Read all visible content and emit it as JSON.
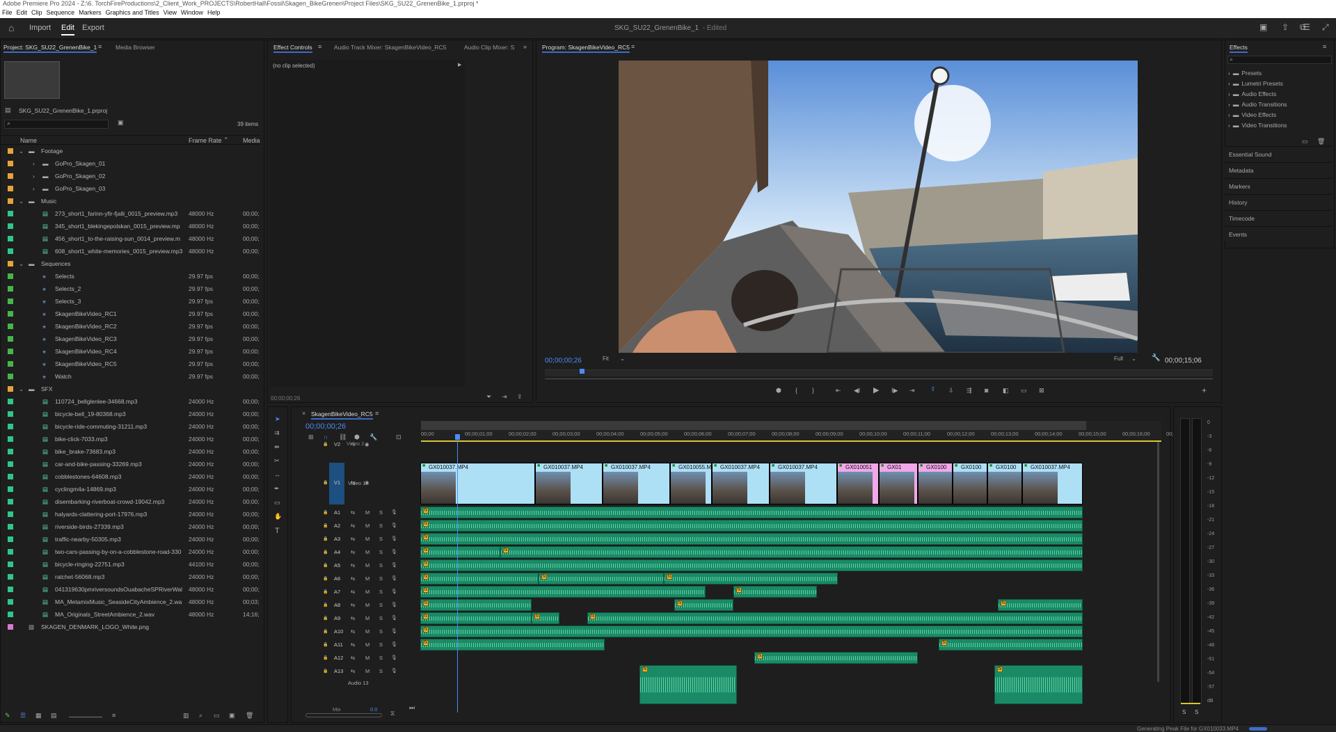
{
  "app": {
    "title": "Adobe Premiere Pro 2024 - Z:\\6. TorchFireProductions\\2_Client_Work_PROJECTS\\RobertHall\\Fossil\\Skagen_BikeGrenen\\Project Files\\SKG_SU22_GrenenBike_1.prproj *"
  },
  "menu": [
    "File",
    "Edit",
    "Clip",
    "Sequence",
    "Markers",
    "Graphics and Titles",
    "View",
    "Window",
    "Help"
  ],
  "header": {
    "tabs": [
      "Import",
      "Edit",
      "Export"
    ],
    "active": "Edit",
    "project_title": "SKG_SU22_GrenenBike_1",
    "edited": "- Edited"
  },
  "project": {
    "tabs": [
      "Project: SKG_SU22_GrenenBike_1",
      "Media Browser"
    ],
    "file": "SKG_SU22_GrenenBike_1.prproj",
    "count": "39 items",
    "col_name": "Name",
    "col_frame": "Frame Rate",
    "col_media": "Media",
    "rows": [
      {
        "name": "Footage",
        "lvl": 1,
        "type": "bin",
        "color": "#e8a23a",
        "fr": "",
        "md": ""
      },
      {
        "name": "GoPro_Skagen_01",
        "lvl": 2,
        "type": "bin",
        "color": "#e8a23a",
        "fr": "",
        "md": ""
      },
      {
        "name": "GoPro_Skagen_02",
        "lvl": 2,
        "type": "bin",
        "color": "#e8a23a",
        "fr": "",
        "md": ""
      },
      {
        "name": "GoPro_Skagen_03",
        "lvl": 2,
        "type": "bin",
        "color": "#e8a23a",
        "fr": "",
        "md": ""
      },
      {
        "name": "Music",
        "lvl": 1,
        "type": "bin",
        "color": "#e8a23a",
        "fr": "",
        "md": ""
      },
      {
        "name": "273_short1_farinn-yfir-fjalli_0015_preview.mp3",
        "lvl": 2,
        "type": "audio",
        "color": "#2fc68a",
        "fr": "48000 Hz",
        "md": "00;00;"
      },
      {
        "name": "345_short1_blekingepolskan_0015_preview.mp",
        "lvl": 2,
        "type": "audio",
        "color": "#2fc68a",
        "fr": "48000 Hz",
        "md": "00;00;"
      },
      {
        "name": "456_short1_to-the-raising-sun_0014_preview.m",
        "lvl": 2,
        "type": "audio",
        "color": "#2fc68a",
        "fr": "48000 Hz",
        "md": "00;00;"
      },
      {
        "name": "608_short1_white-memories_0015_preview.mp3",
        "lvl": 2,
        "type": "audio",
        "color": "#2fc68a",
        "fr": "48000 Hz",
        "md": "00;00;"
      },
      {
        "name": "Sequences",
        "lvl": 1,
        "type": "bin",
        "color": "#e8a23a",
        "fr": "",
        "md": ""
      },
      {
        "name": "Selects",
        "lvl": 2,
        "type": "seq",
        "color": "#47b54a",
        "fr": "29.97 fps",
        "md": "00;00;"
      },
      {
        "name": "Selects_2",
        "lvl": 2,
        "type": "seq",
        "color": "#47b54a",
        "fr": "29.97 fps",
        "md": "00;00;"
      },
      {
        "name": "Selects_3",
        "lvl": 2,
        "type": "seq",
        "color": "#47b54a",
        "fr": "29.97 fps",
        "md": "00;00;"
      },
      {
        "name": "SkagenBikeVideo_RC1",
        "lvl": 2,
        "type": "seq",
        "color": "#47b54a",
        "fr": "29.97 fps",
        "md": "00;00;"
      },
      {
        "name": "SkagenBikeVideo_RC2",
        "lvl": 2,
        "type": "seq",
        "color": "#47b54a",
        "fr": "29.97 fps",
        "md": "00;00;"
      },
      {
        "name": "SkagenBikeVideo_RC3",
        "lvl": 2,
        "type": "seq",
        "color": "#47b54a",
        "fr": "29.97 fps",
        "md": "00;00;"
      },
      {
        "name": "SkagenBikeVideo_RC4",
        "lvl": 2,
        "type": "seq",
        "color": "#47b54a",
        "fr": "29.97 fps",
        "md": "00;00;"
      },
      {
        "name": "SkagenBikeVideo_RC5",
        "lvl": 2,
        "type": "seq",
        "color": "#47b54a",
        "fr": "29.97 fps",
        "md": "00;00;"
      },
      {
        "name": "Watch",
        "lvl": 2,
        "type": "seq",
        "color": "#47b54a",
        "fr": "29.97 fps",
        "md": "00;00;"
      },
      {
        "name": "SFX",
        "lvl": 1,
        "type": "bin",
        "color": "#e8a23a",
        "fr": "",
        "md": ""
      },
      {
        "name": "110724_bellglenlee-34668.mp3",
        "lvl": 2,
        "type": "audio",
        "color": "#2fc68a",
        "fr": "24000 Hz",
        "md": "00;00;"
      },
      {
        "name": "bicycle-bell_19-80368.mp3",
        "lvl": 2,
        "type": "audio",
        "color": "#2fc68a",
        "fr": "24000 Hz",
        "md": "00;00;"
      },
      {
        "name": "bicycle-ride-commuting-31211.mp3",
        "lvl": 2,
        "type": "audio",
        "color": "#2fc68a",
        "fr": "24000 Hz",
        "md": "00;00;"
      },
      {
        "name": "bike-click-7033.mp3",
        "lvl": 2,
        "type": "audio",
        "color": "#2fc68a",
        "fr": "24000 Hz",
        "md": "00;00;"
      },
      {
        "name": "bike_brake-73683.mp3",
        "lvl": 2,
        "type": "audio",
        "color": "#2fc68a",
        "fr": "24000 Hz",
        "md": "00;00;"
      },
      {
        "name": "car-and-bike-passing-33269.mp3",
        "lvl": 2,
        "type": "audio",
        "color": "#2fc68a",
        "fr": "24000 Hz",
        "md": "00;00;"
      },
      {
        "name": "cobblestones-64608.mp3",
        "lvl": 2,
        "type": "audio",
        "color": "#2fc68a",
        "fr": "24000 Hz",
        "md": "00;00;"
      },
      {
        "name": "cyclingm4a-14869.mp3",
        "lvl": 2,
        "type": "audio",
        "color": "#2fc68a",
        "fr": "24000 Hz",
        "md": "00;00;"
      },
      {
        "name": "disembarking-riverboat-crowd-19042.mp3",
        "lvl": 2,
        "type": "audio",
        "color": "#2fc68a",
        "fr": "24000 Hz",
        "md": "00;00;"
      },
      {
        "name": "halyards-clattering-port-17976.mp3",
        "lvl": 2,
        "type": "audio",
        "color": "#2fc68a",
        "fr": "24000 Hz",
        "md": "00;00;"
      },
      {
        "name": "riverside-birds-27339.mp3",
        "lvl": 2,
        "type": "audio",
        "color": "#2fc68a",
        "fr": "24000 Hz",
        "md": "00;00;"
      },
      {
        "name": "traffic-nearby-50305.mp3",
        "lvl": 2,
        "type": "audio",
        "color": "#2fc68a",
        "fr": "24000 Hz",
        "md": "00;00;"
      },
      {
        "name": "two-cars-passing-by-on-a-cobblestone-road-330",
        "lvl": 2,
        "type": "audio",
        "color": "#2fc68a",
        "fr": "24000 Hz",
        "md": "00;00;"
      },
      {
        "name": "bicycle-ringing-22751.mp3",
        "lvl": 2,
        "type": "audio",
        "color": "#2fc68a",
        "fr": "44100 Hz",
        "md": "00;00;"
      },
      {
        "name": "ratchet-56068.mp3",
        "lvl": 2,
        "type": "audio",
        "color": "#2fc68a",
        "fr": "24000 Hz",
        "md": "00;00;"
      },
      {
        "name": "041319630pmriversoundsOuabacheSPRiverWal",
        "lvl": 2,
        "type": "audio",
        "color": "#2fc68a",
        "fr": "48000 Hz",
        "md": "00;00;"
      },
      {
        "name": "MA_MetamixMusic_SeasideCityAmbience_2.wa",
        "lvl": 2,
        "type": "audio",
        "color": "#2fc68a",
        "fr": "48000 Hz",
        "md": "00;03;"
      },
      {
        "name": "MA_Originals_StreetAmbience_2.wav",
        "lvl": 2,
        "type": "audio",
        "color": "#2fc68a",
        "fr": "48000 Hz",
        "md": "14;16;"
      },
      {
        "name": "SKAGEN_DENMARK_LOGO_White.png",
        "lvl": 1,
        "type": "image",
        "color": "#d97ad0",
        "fr": "",
        "md": ""
      }
    ]
  },
  "effect_controls": {
    "tabs": [
      "Effect Controls",
      "Audio Track Mixer: SkagenBikeVideo_RC5",
      "Audio Clip Mixer: S"
    ],
    "no_clip": "(no clip selected)",
    "time": "00;00;00;26"
  },
  "program": {
    "tab": "Program: SkagenBikeVideo_RC5",
    "timecode": "00;00;00;26",
    "fit": "Fit",
    "full": "Full",
    "duration": "00;00;15;06"
  },
  "effects": {
    "tab": "Effects",
    "items": [
      "Presets",
      "Lumetri Presets",
      "Audio Effects",
      "Audio Transitions",
      "Video Effects",
      "Video Transitions"
    ],
    "sections": [
      "Essential Sound",
      "Metadata",
      "Markers",
      "History",
      "Timecode",
      "Events"
    ]
  },
  "timeline": {
    "tab": "SkagenBikeVideo_RC5",
    "timecode": "00;00;00;26",
    "ruler": [
      "00;00",
      "00;00;01;00",
      "00;00;02;00",
      "00;00;03;00",
      "00;00;04;00",
      "00;00;05;00",
      "00;00;06;00",
      "00;00;07;00",
      "00;00;08;00",
      "00;00;09;00",
      "00;00;10;00",
      "00;00;11;00",
      "00;00;12;00",
      "00;00;13;00",
      "00;00;14;00",
      "00;00;15;00",
      "00;00;16;00",
      "00;"
    ],
    "v2": "V2",
    "video2": "Video 2",
    "v1": "V1",
    "video1": "Video 1",
    "video_clips": [
      {
        "name": "GX010037.MP4",
        "color": "#aee0f5"
      },
      {
        "name": "GX010037.MP4",
        "color": "#aee0f5"
      },
      {
        "name": "GX010037.MP4",
        "color": "#aee0f5"
      },
      {
        "name": "GX010055.MP4",
        "color": "#aee0f5"
      },
      {
        "name": "GX010037.MP4",
        "color": "#aee0f5"
      },
      {
        "name": "GX010037.MP4",
        "color": "#aee0f5"
      },
      {
        "name": "GX010051",
        "color": "#f0a8e8"
      },
      {
        "name": "GX01",
        "color": "#f0a8e8"
      },
      {
        "name": "GX0100",
        "color": "#f0a8e8"
      },
      {
        "name": "GX0100",
        "color": "#aee0f5"
      },
      {
        "name": "GX0100",
        "color": "#aee0f5"
      },
      {
        "name": "GX010037.MP4",
        "color": "#aee0f5"
      }
    ],
    "audio_tracks": [
      "A1",
      "A2",
      "A3",
      "A4",
      "A5",
      "A6",
      "A7",
      "A8",
      "A9",
      "A10",
      "A11",
      "A12",
      "A13"
    ],
    "audio13": "Audio 13",
    "mix": "Mix",
    "mix_val": "0.0",
    "btn_m": "M",
    "btn_s": "S",
    "meter": [
      "0",
      "-3",
      "-6",
      "-9",
      "-12",
      "-15",
      "-18",
      "-21",
      "-24",
      "-27",
      "-30",
      "-33",
      "-36",
      "-39",
      "-42",
      "-45",
      "-48",
      "-51",
      "-54",
      "-57",
      "dB"
    ],
    "meter_s": "S"
  },
  "status": {
    "text": "Generating Peak File for GX010033.MP4"
  },
  "colors": {
    "accent": "#3d6dcc",
    "audio": "#1a8a66",
    "wave": "#5fd3a6",
    "fx": "#e4b83c"
  }
}
